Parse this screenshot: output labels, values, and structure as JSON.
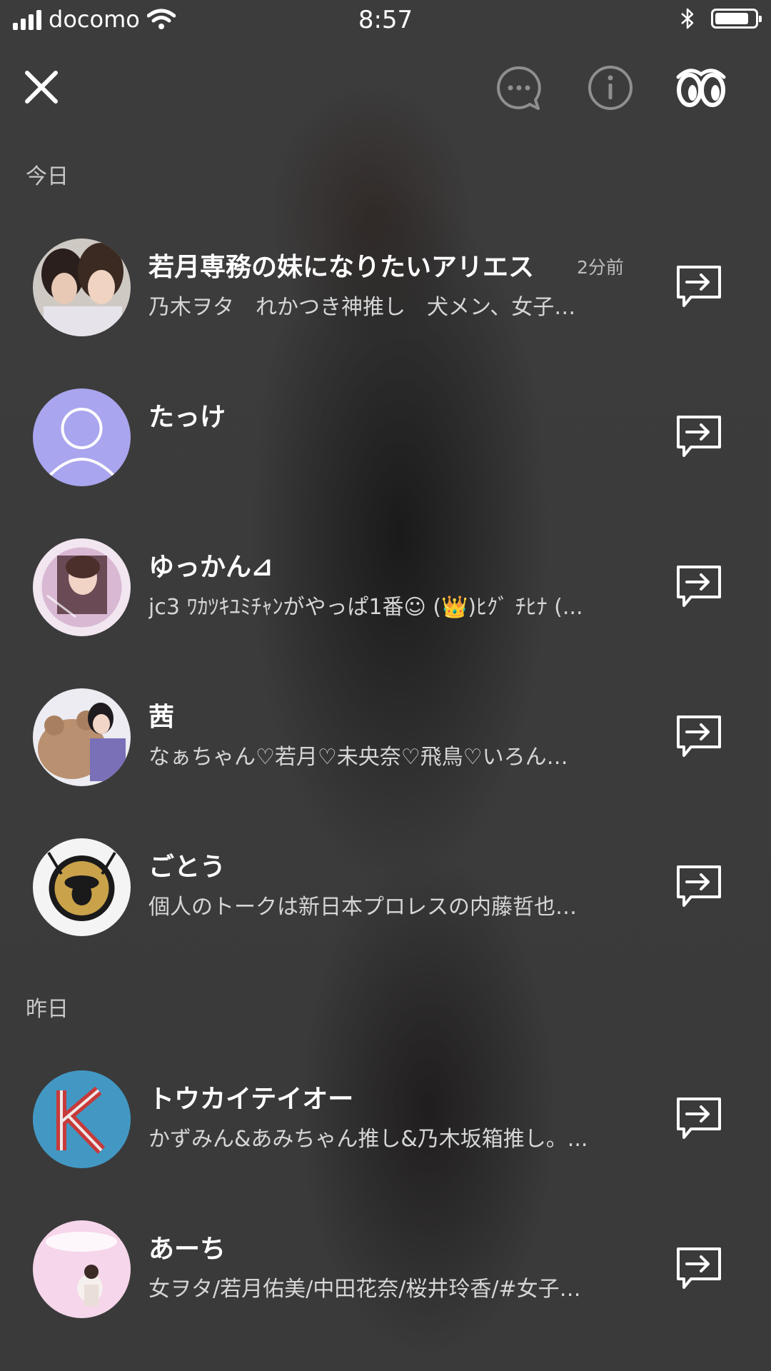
{
  "status_bar": {
    "carrier": "docomo",
    "time": "8:57",
    "battery_level": 0.85
  },
  "nav": {
    "icons": [
      "close-icon",
      "chat-bubble-icon",
      "info-icon",
      "look-icon"
    ]
  },
  "sections": [
    {
      "label": "今日",
      "rows": [
        {
          "name": "若月専務の妹になりたいアリエス",
          "time": "2分前",
          "desc": "乃木ヲタ　れかつき神推し　犬メン、女子…"
        },
        {
          "name": "たっけ",
          "time": "",
          "desc": ""
        },
        {
          "name": "ゆっかん⊿",
          "time": "",
          "desc": "jc3 ﾜｶﾂｷﾕﾐﾁｬﾝがやっぱ1番☺ (👑)ﾋｸﾞ ﾁﾋﾅ (..."
        },
        {
          "name": "茜",
          "time": "",
          "desc": "なぁちゃん♡若月♡未央奈♡飛鳥♡いろん…"
        },
        {
          "name": "ごとう",
          "time": "",
          "desc": "個人のトークは新日本プロレスの内藤哲也…"
        }
      ]
    },
    {
      "label": "昨日",
      "rows": [
        {
          "name": "トウカイテイオー",
          "time": "",
          "desc": "かずみん&あみちゃん推し&乃木坂箱推し。..."
        },
        {
          "name": "あーち",
          "time": "",
          "desc": "女ヲタ/若月佑美/中田花奈/桜井玲香/#女子…"
        }
      ]
    }
  ],
  "colors": {
    "background": "#3a3a3a",
    "default_avatar": "#a9a5ee",
    "secondary_text": "#d6d6d6"
  }
}
